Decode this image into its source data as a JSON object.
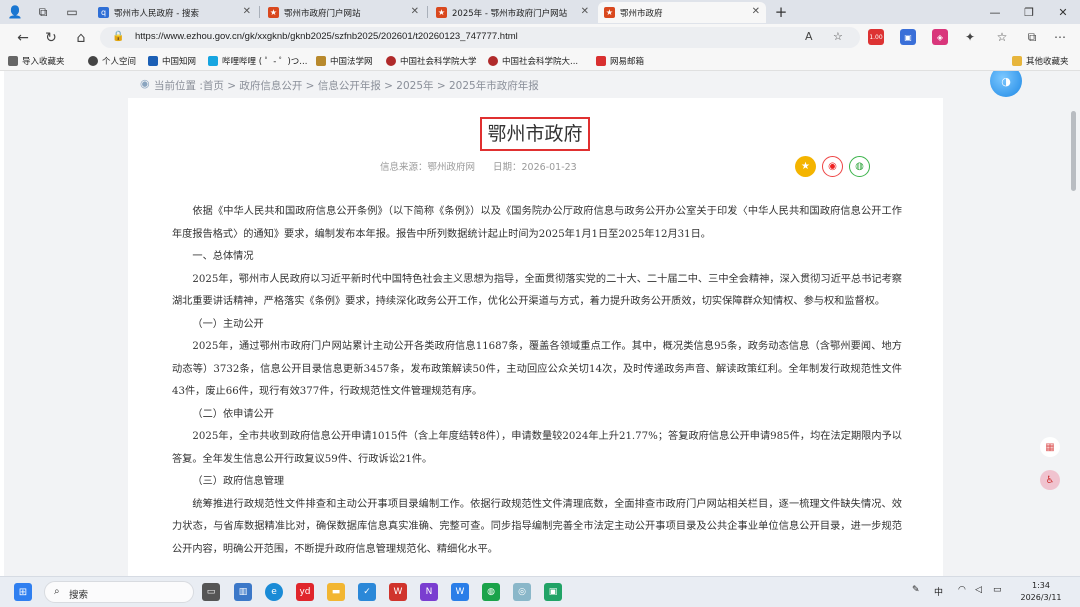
{
  "browser": {
    "tabs": [
      {
        "label": "鄂州市人民政府 - 搜索",
        "active": false
      },
      {
        "label": "鄂州市政府门户网站",
        "active": false
      },
      {
        "label": "2025年 - 鄂州市政府门户网站",
        "active": false
      },
      {
        "label": "鄂州市政府",
        "active": true
      }
    ],
    "new_tab": "+",
    "url": "https://www.ezhou.gov.cn/gk/xxgknb/gknb2025/szfnb2025/202601/t20260123_747777.html",
    "badge": "1.00"
  },
  "bookmarks": {
    "items": [
      {
        "label": "导入收藏夹"
      },
      {
        "label": "个人空间"
      },
      {
        "label": "中国知网"
      },
      {
        "label": "哔哩哔哩 ( ゜- ゜)つ..."
      },
      {
        "label": "中国法学网"
      },
      {
        "label": "中国社会科学院大学"
      },
      {
        "label": "中国社会科学院大..."
      },
      {
        "label": "网易邮箱"
      }
    ],
    "other": "其他收藏夹"
  },
  "breadcrumb": {
    "text": "当前位置 :首页 > 政府信息公开 > 信息公开年报 > 2025年 > 2025年市政府年报"
  },
  "article": {
    "title": "鄂州市政府",
    "source": "信息来源：鄂州政府网",
    "date": "日期：2026-01-23",
    "paragraphs": [
      "依据《中华人民共和国政府信息公开条例》（以下简称《条例》）以及《国务院办公厅政府信息与政务公开办公室关于印发〈中华人民共和国政府信息公开工作年度报告格式〉的通知》要求，编制发布本年报。报告中所列数据统计起止时间为2025年1月1日至2025年12月31日。",
      "一、总体情况",
      "2025年，鄂州市人民政府以习近平新时代中国特色社会主义思想为指导，全面贯彻落实党的二十大、二十届二中、三中全会精神，深入贯彻习近平总书记考察湖北重要讲话精神，严格落实《条例》要求，持续深化政务公开工作，优化公开渠道与方式，着力提升政务公开质效，切实保障群众知情权、参与权和监督权。",
      "（一）主动公开",
      "2025年，通过鄂州市政府门户网站累计主动公开各类政府信息11687条，覆盖各领域重点工作。其中，概况类信息95条，政务动态信息（含鄂州要闻、地方动态等）3732条，信息公开目录信息更新3457条，发布政策解读50件，主动回应公众关切14次，及时传递政务声音、解读政策红利。全年制发行政规范性文件43件，废止66件，现行有效377件，行政规范性文件管理规范有序。",
      "（二）依申请公开",
      "2025年，全市共收到政府信息公开申请1015件（含上年度结转8件），申请数量较2024年上升21.77%；答复政府信息公开申请985件，均在法定期限内予以答复。全年发生信息公开行政复议59件、行政诉讼21件。",
      "（三）政府信息管理",
      "统筹推进行政规范性文件排查和主动公开事项目录编制工作。依据行政规范性文件清理底数，全面排查市政府门户网站相关栏目，逐一梳理文件缺失情况、效力状态，与省库数据精准比对，确保数据库信息真实准确、完整可查。同步指导编制完善全市法定主动公开事项目录及公共企事业单位信息公开目录，进一步规范公开内容，明确公开范围，不断提升政府信息管理规范化、精细化水平。"
    ]
  },
  "taskbar": {
    "search_label": "搜索",
    "ime": "中",
    "time": "1:34",
    "date": "2026/3/11"
  }
}
